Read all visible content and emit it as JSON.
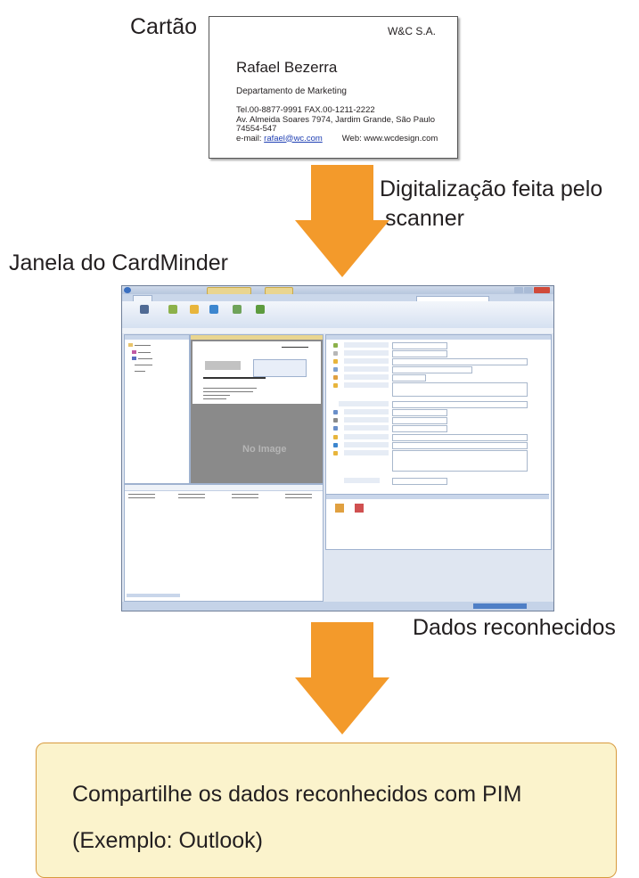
{
  "labels": {
    "card": "Cartão",
    "scan_line1": "Digitalização feita pelo",
    "scan_line2": "scanner",
    "window": "Janela do CardMinder",
    "recognized": "Dados reconhecidos"
  },
  "business_card": {
    "company": "W&C  S.A.",
    "name": "Rafael Bezerra",
    "department": "Departamento de Marketing",
    "phone_fax": "Tel.00-8877-9991   FAX.00-1211-2222",
    "address": "Av. Almeida Soares 7974, Jardim Grande, São Paulo",
    "postal": "74554-547",
    "email_prefix": "e-mail: ",
    "email": "rafael@wc.com",
    "web": "Web: www.wcdesign.com"
  },
  "screenshot": {
    "no_image": "No Image"
  },
  "note": {
    "line1": "Compartilhe os dados reconhecidos com PIM",
    "line2": "(Exemplo: Outlook)"
  },
  "colors": {
    "arrow": "#f39a2b",
    "note_background": "#fbf3cc",
    "note_border": "#d89a3e"
  }
}
